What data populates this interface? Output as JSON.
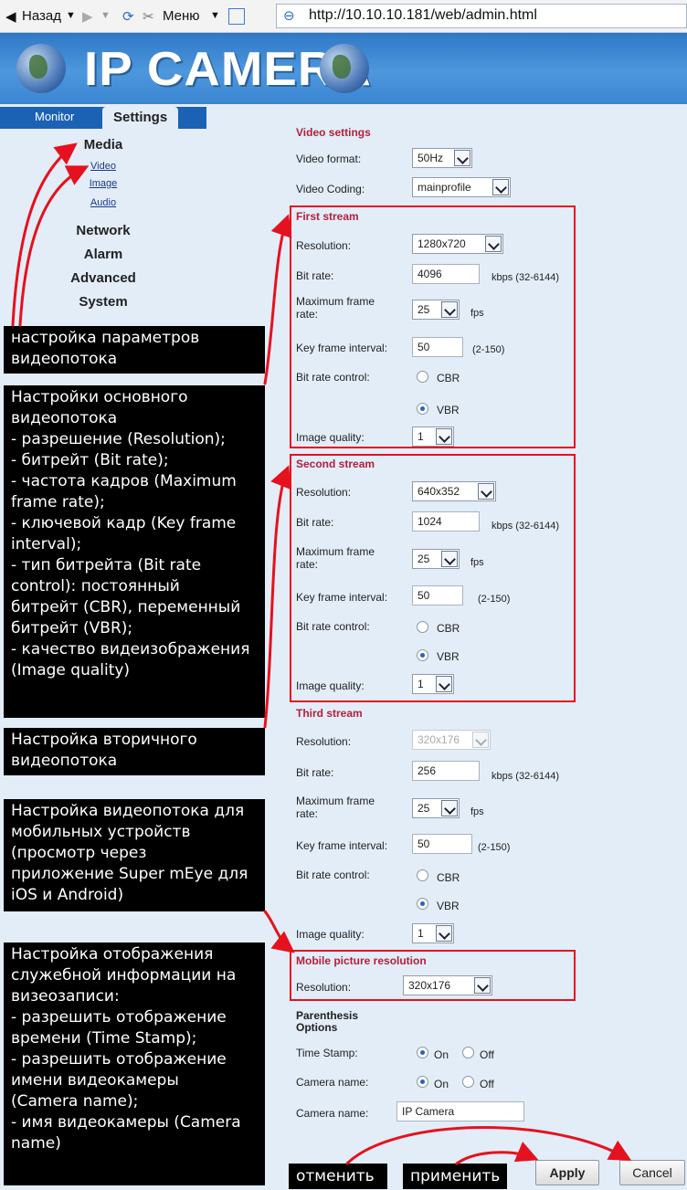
{
  "toolbar": {
    "back_label": "Назад",
    "menu_label": "Меню",
    "url": "http://10.10.10.181/web/admin.html"
  },
  "banner": {
    "title": "IP CAMERA"
  },
  "tabs": {
    "monitor": "Monitor",
    "settings": "Settings"
  },
  "nav": {
    "media": "Media",
    "video": "Video",
    "image": "Image",
    "audio": "Audio",
    "network": "Network",
    "alarm": "Alarm",
    "advanced": "Advanced",
    "system": "System"
  },
  "notes": {
    "n1": "настройка параметров\nвидеопотока",
    "n2": "Настройки основного\nвидеопотока\n- разрешение (Resolution);\n- битрейт (Bit rate);\n- частота кадров (Maximum\nframe rate);\n- ключевой кадр (Key frame\ninterval);\n- тип битрейта (Bit rate\ncontrol): постоянный\nбитрейт (CBR), переменный\nбитрейт (VBR);\n- качество видеизображения\n(Image quality)",
    "n3": "Настройка вторичного\nвидеопотока",
    "n4": "Настройка видеопотока для\nмобильных устройств\n(просмотр через\nприложение Super mEye для\niOS и Android)",
    "n5": "Настройка отображения\nслужебной информации на\nвизеозаписи:\n- разрешить отображение\nвремени (Time Stamp);\n- разрешить отображение\nимени видеокамеры\n(Camera name);\n- имя видеокамеры (Camera\nname)",
    "cancel_note": "отменить",
    "apply_note": "применить"
  },
  "video": {
    "title": "Video settings",
    "format_label": "Video format:",
    "format_value": "50Hz",
    "coding_label": "Video Coding:",
    "coding_value": "mainprofile"
  },
  "labels": {
    "resolution": "Resolution:",
    "bitrate": "Bit rate:",
    "maxfr_1": "Maximum frame",
    "maxfr_2": "rate:",
    "keyframe": "Key frame interval:",
    "brc": "Bit rate control:",
    "quality": "Image quality:",
    "cbr": "CBR",
    "vbr": "VBR",
    "fps": "fps",
    "kbps": "kbps (32-6144)",
    "kf_range": "(2-150)"
  },
  "first": {
    "title": "First stream",
    "resolution": "1280x720",
    "bitrate": "4096",
    "fps": "25",
    "keyframe": "50",
    "quality": "1"
  },
  "second": {
    "title": "Second stream",
    "resolution": "640x352",
    "bitrate": "1024",
    "fps": "25",
    "keyframe": "50",
    "quality": "1"
  },
  "third": {
    "title": "Third stream",
    "resolution": "320x176",
    "bitrate": "256",
    "fps": "25",
    "keyframe": "50",
    "quality": "1"
  },
  "mobile": {
    "title": "Mobile picture resolution",
    "resolution": "320x176"
  },
  "parenthesis": {
    "title_1": "Parenthesis",
    "title_2": "Options",
    "timestamp_label": "Time Stamp:",
    "camname_label": "Camera name:",
    "on": "On",
    "off": "Off",
    "camname_value": "IP Camera"
  },
  "buttons": {
    "apply": "Apply",
    "cancel": "Cancel"
  },
  "colors": {
    "annotation_red": "#e6111e",
    "section_title": "#b4203a",
    "nav_bar": "#1b62b5"
  }
}
